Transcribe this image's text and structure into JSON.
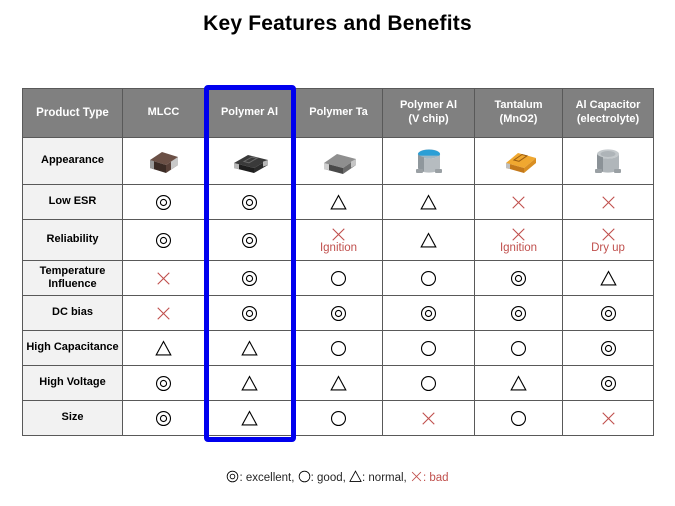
{
  "title": "Key Features and Benefits",
  "table": {
    "columns": [
      {
        "id": "product-type",
        "label": "Product Type",
        "sub": ""
      },
      {
        "id": "mlcc",
        "label": "MLCC",
        "sub": ""
      },
      {
        "id": "polymer-al",
        "label": "Polymer Al",
        "sub": "",
        "highlighted": true
      },
      {
        "id": "polymer-ta",
        "label": "Polymer Ta",
        "sub": ""
      },
      {
        "id": "polymer-al-v-chip",
        "label": "Polymer Al",
        "sub": "(V chip)"
      },
      {
        "id": "tantalum-mno2",
        "label": "Tantalum",
        "sub": "(MnO2)"
      },
      {
        "id": "al-capacitor-electrolyte",
        "label": "Al Capacitor",
        "sub": "(electrolyte)"
      }
    ],
    "rows": [
      {
        "id": "appearance",
        "label": "Appearance",
        "type": "image",
        "cells": [
          {
            "icon": "mlcc-chip-icon"
          },
          {
            "icon": "polymer-al-chip-icon"
          },
          {
            "icon": "polymer-ta-chip-icon"
          },
          {
            "icon": "polymer-al-vchip-can-icon"
          },
          {
            "icon": "tantalum-mno2-chip-icon"
          },
          {
            "icon": "al-electrolytic-can-icon"
          }
        ]
      },
      {
        "id": "low-esr",
        "label": "Low ESR",
        "type": "rating",
        "cells": [
          {
            "sym": "excellent"
          },
          {
            "sym": "excellent"
          },
          {
            "sym": "normal"
          },
          {
            "sym": "normal"
          },
          {
            "sym": "bad"
          },
          {
            "sym": "bad"
          }
        ]
      },
      {
        "id": "reliability",
        "label": "Reliability",
        "type": "rating",
        "cells": [
          {
            "sym": "excellent"
          },
          {
            "sym": "excellent"
          },
          {
            "sym": "bad",
            "note": "Ignition"
          },
          {
            "sym": "normal"
          },
          {
            "sym": "bad",
            "note": "Ignition"
          },
          {
            "sym": "bad",
            "note": "Dry up"
          }
        ]
      },
      {
        "id": "temperature-influence",
        "label": "Temperature Influence",
        "type": "rating",
        "cells": [
          {
            "sym": "bad"
          },
          {
            "sym": "excellent"
          },
          {
            "sym": "good"
          },
          {
            "sym": "good"
          },
          {
            "sym": "excellent"
          },
          {
            "sym": "normal"
          }
        ]
      },
      {
        "id": "dc-bias",
        "label": "DC bias",
        "type": "rating",
        "cells": [
          {
            "sym": "bad"
          },
          {
            "sym": "excellent"
          },
          {
            "sym": "excellent"
          },
          {
            "sym": "excellent"
          },
          {
            "sym": "excellent"
          },
          {
            "sym": "excellent"
          }
        ]
      },
      {
        "id": "high-capacitance",
        "label": "High Capacitance",
        "type": "rating",
        "cells": [
          {
            "sym": "normal"
          },
          {
            "sym": "normal"
          },
          {
            "sym": "good"
          },
          {
            "sym": "good"
          },
          {
            "sym": "good"
          },
          {
            "sym": "excellent"
          }
        ]
      },
      {
        "id": "high-voltage",
        "label": "High Voltage",
        "type": "rating",
        "cells": [
          {
            "sym": "excellent"
          },
          {
            "sym": "normal"
          },
          {
            "sym": "normal"
          },
          {
            "sym": "good"
          },
          {
            "sym": "normal"
          },
          {
            "sym": "excellent"
          }
        ]
      },
      {
        "id": "size",
        "label": "Size",
        "type": "rating",
        "cells": [
          {
            "sym": "excellent"
          },
          {
            "sym": "normal"
          },
          {
            "sym": "good"
          },
          {
            "sym": "bad"
          },
          {
            "sym": "good"
          },
          {
            "sym": "bad"
          }
        ]
      }
    ]
  },
  "legend": {
    "items": [
      {
        "sym": "excellent",
        "label": ": excellent,"
      },
      {
        "sym": "good",
        "label": ": good,"
      },
      {
        "sym": "normal",
        "label": ": normal,"
      },
      {
        "sym": "bad",
        "label": ": bad"
      }
    ]
  },
  "colors": {
    "header_bg": "#808080",
    "rowlabel_bg": "#f2f2f2",
    "border": "#595959",
    "highlight": "#0000ee",
    "bad_red": "#c0504d",
    "text": "#000000"
  }
}
